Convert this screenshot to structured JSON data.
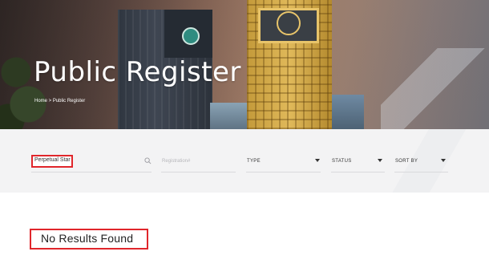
{
  "hero": {
    "title": "Public Register",
    "breadcrumb": "Home > Public Register"
  },
  "filters": {
    "search": {
      "value": "Perpetual Star",
      "icon": "search-icon"
    },
    "registration": {
      "placeholder": "Registration#"
    },
    "type": {
      "label": "TYPE"
    },
    "status": {
      "label": "STATUS"
    },
    "sort": {
      "label": "SORT BY"
    }
  },
  "results": {
    "message": "No Results Found"
  },
  "colors": {
    "highlight": "#e0262b",
    "filter_bar": "#f3f3f4"
  }
}
